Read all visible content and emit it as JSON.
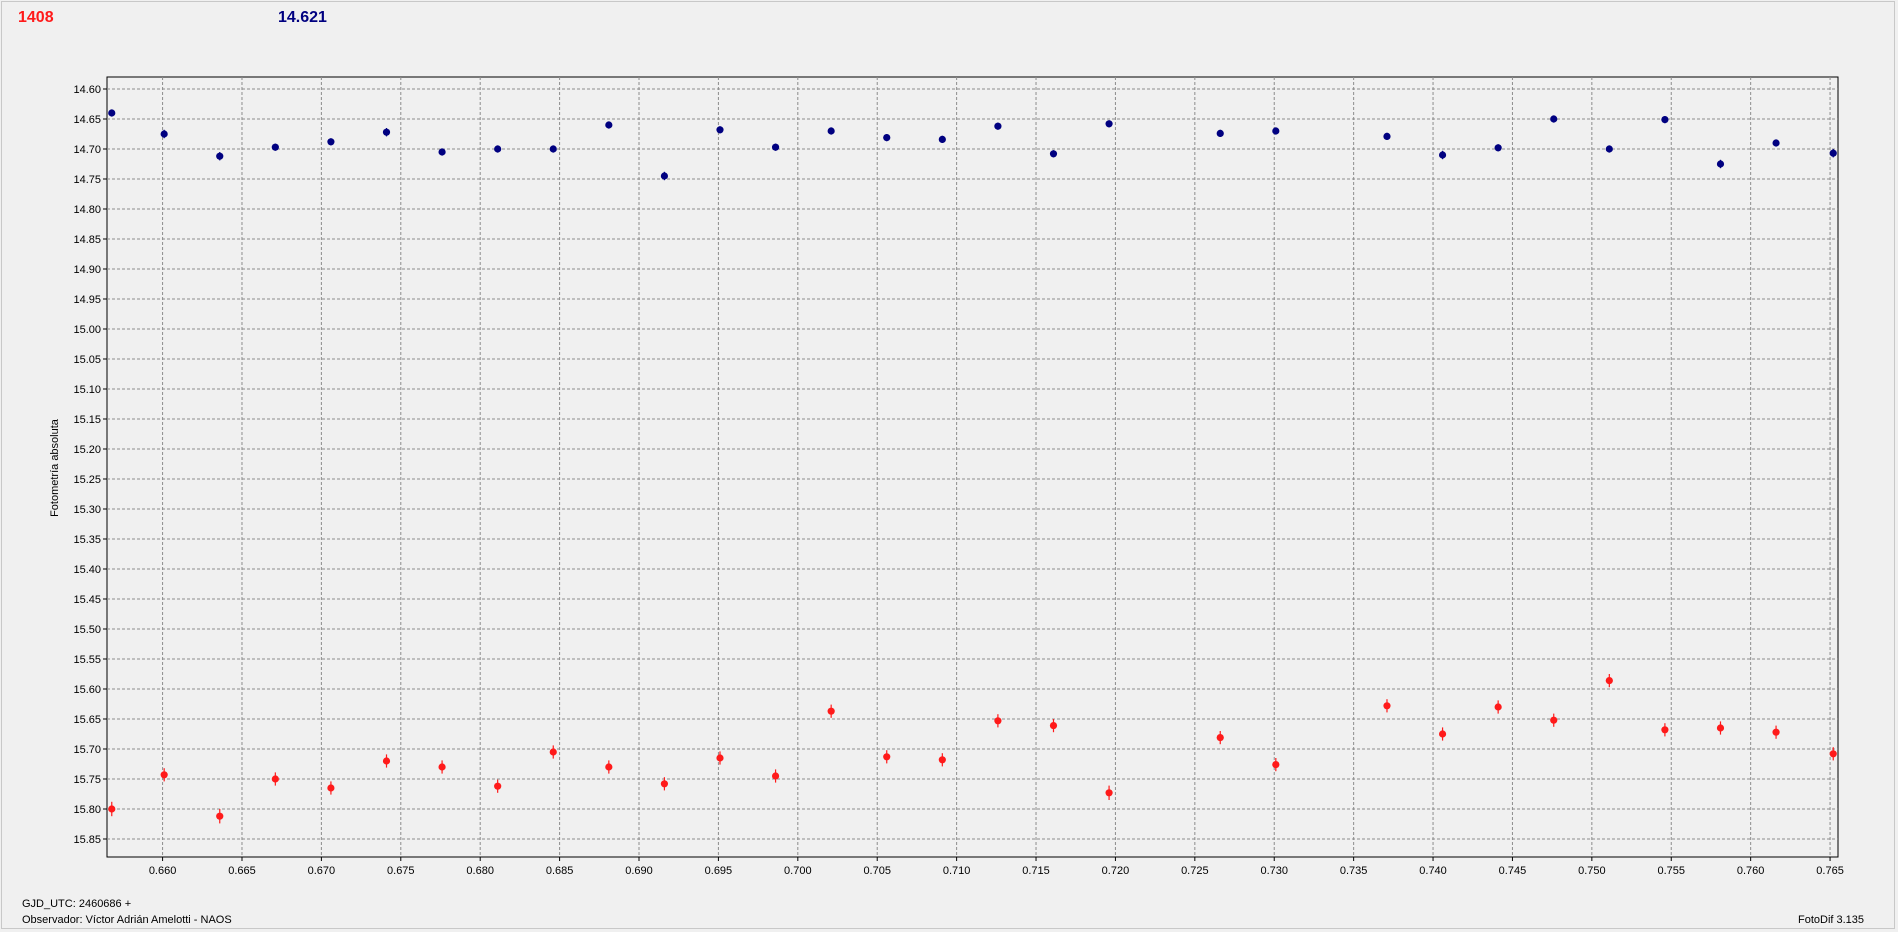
{
  "header": {
    "target_value": "1408",
    "reference_value": "14.621"
  },
  "footer": {
    "gjd": "GJD_UTC: 2460686 +",
    "observer": "Observador: Víctor Adrián Amelotti - NAOS",
    "software": "FotoDif 3.135"
  },
  "colors": {
    "background": "#f0f0f0",
    "grid": "#8c8c8c",
    "red_series": "#ff1a1a",
    "blue_series": "#000080"
  },
  "chart_data": {
    "type": "scatter",
    "title": "",
    "xlabel": "",
    "ylabel": "Fotometría absoluta",
    "xlim": [
      0.6565,
      0.7655
    ],
    "ylim": [
      15.88,
      14.58
    ],
    "y_inverted": true,
    "grid": true,
    "xticks": [
      "0.660",
      "0.665",
      "0.670",
      "0.675",
      "0.680",
      "0.685",
      "0.690",
      "0.695",
      "0.700",
      "0.705",
      "0.710",
      "0.715",
      "0.720",
      "0.725",
      "0.730",
      "0.735",
      "0.740",
      "0.745",
      "0.750",
      "0.755",
      "0.760",
      "0.765"
    ],
    "yticks": [
      "14.60",
      "14.65",
      "14.70",
      "14.75",
      "14.80",
      "14.85",
      "14.90",
      "14.95",
      "15.00",
      "15.05",
      "15.10",
      "15.15",
      "15.20",
      "15.25",
      "15.30",
      "15.35",
      "15.40",
      "15.45",
      "15.50",
      "15.55",
      "15.60",
      "15.65",
      "15.70",
      "15.75",
      "15.80",
      "15.85"
    ],
    "series": [
      {
        "color": "#000080",
        "x": [
          0.6568,
          0.6601,
          0.6636,
          0.6671,
          0.6706,
          0.6741,
          0.6776,
          0.6811,
          0.6846,
          0.6881,
          0.6916,
          0.6951,
          0.6986,
          0.7021,
          0.7056,
          0.7091,
          0.7126,
          0.7161,
          0.7196,
          0.7266,
          0.7301,
          0.7371,
          0.7406,
          0.7441,
          0.7476,
          0.7511,
          0.7546,
          0.7581,
          0.7616,
          0.7652
        ],
        "y": [
          14.64,
          14.675,
          14.712,
          14.697,
          14.688,
          14.672,
          14.705,
          14.7,
          14.7,
          14.66,
          14.745,
          14.668,
          14.697,
          14.67,
          14.681,
          14.684,
          14.662,
          14.708,
          14.658,
          14.674,
          14.67,
          14.679,
          14.71,
          14.698,
          14.65,
          14.7,
          14.651,
          14.725,
          14.69,
          14.707
        ],
        "err": [
          0.006,
          0.007,
          0.007,
          0.006,
          0.006,
          0.007,
          0.006,
          0.006,
          0.006,
          0.006,
          0.007,
          0.006,
          0.006,
          0.006,
          0.006,
          0.006,
          0.006,
          0.006,
          0.006,
          0.006,
          0.006,
          0.006,
          0.007,
          0.006,
          0.006,
          0.006,
          0.006,
          0.007,
          0.006,
          0.007
        ]
      },
      {
        "color": "#ff1a1a",
        "x": [
          0.6568,
          0.6601,
          0.6636,
          0.6671,
          0.6706,
          0.6741,
          0.6776,
          0.6811,
          0.6846,
          0.6881,
          0.6916,
          0.6951,
          0.6986,
          0.7021,
          0.7056,
          0.7091,
          0.7126,
          0.7161,
          0.7196,
          0.7266,
          0.7301,
          0.7371,
          0.7406,
          0.7441,
          0.7476,
          0.7511,
          0.7546,
          0.7581,
          0.7616,
          0.7652
        ],
        "y": [
          15.8,
          15.743,
          15.812,
          15.75,
          15.765,
          15.72,
          15.73,
          15.762,
          15.705,
          15.73,
          15.758,
          15.715,
          15.745,
          15.637,
          15.713,
          15.718,
          15.653,
          15.661,
          15.773,
          15.681,
          15.726,
          15.628,
          15.675,
          15.63,
          15.652,
          15.586,
          15.668,
          15.665,
          15.672,
          15.708
        ],
        "err": [
          0.012,
          0.011,
          0.012,
          0.011,
          0.011,
          0.011,
          0.011,
          0.011,
          0.011,
          0.011,
          0.011,
          0.011,
          0.011,
          0.011,
          0.011,
          0.011,
          0.011,
          0.011,
          0.012,
          0.011,
          0.011,
          0.011,
          0.011,
          0.011,
          0.011,
          0.011,
          0.011,
          0.011,
          0.011,
          0.011
        ]
      }
    ]
  }
}
